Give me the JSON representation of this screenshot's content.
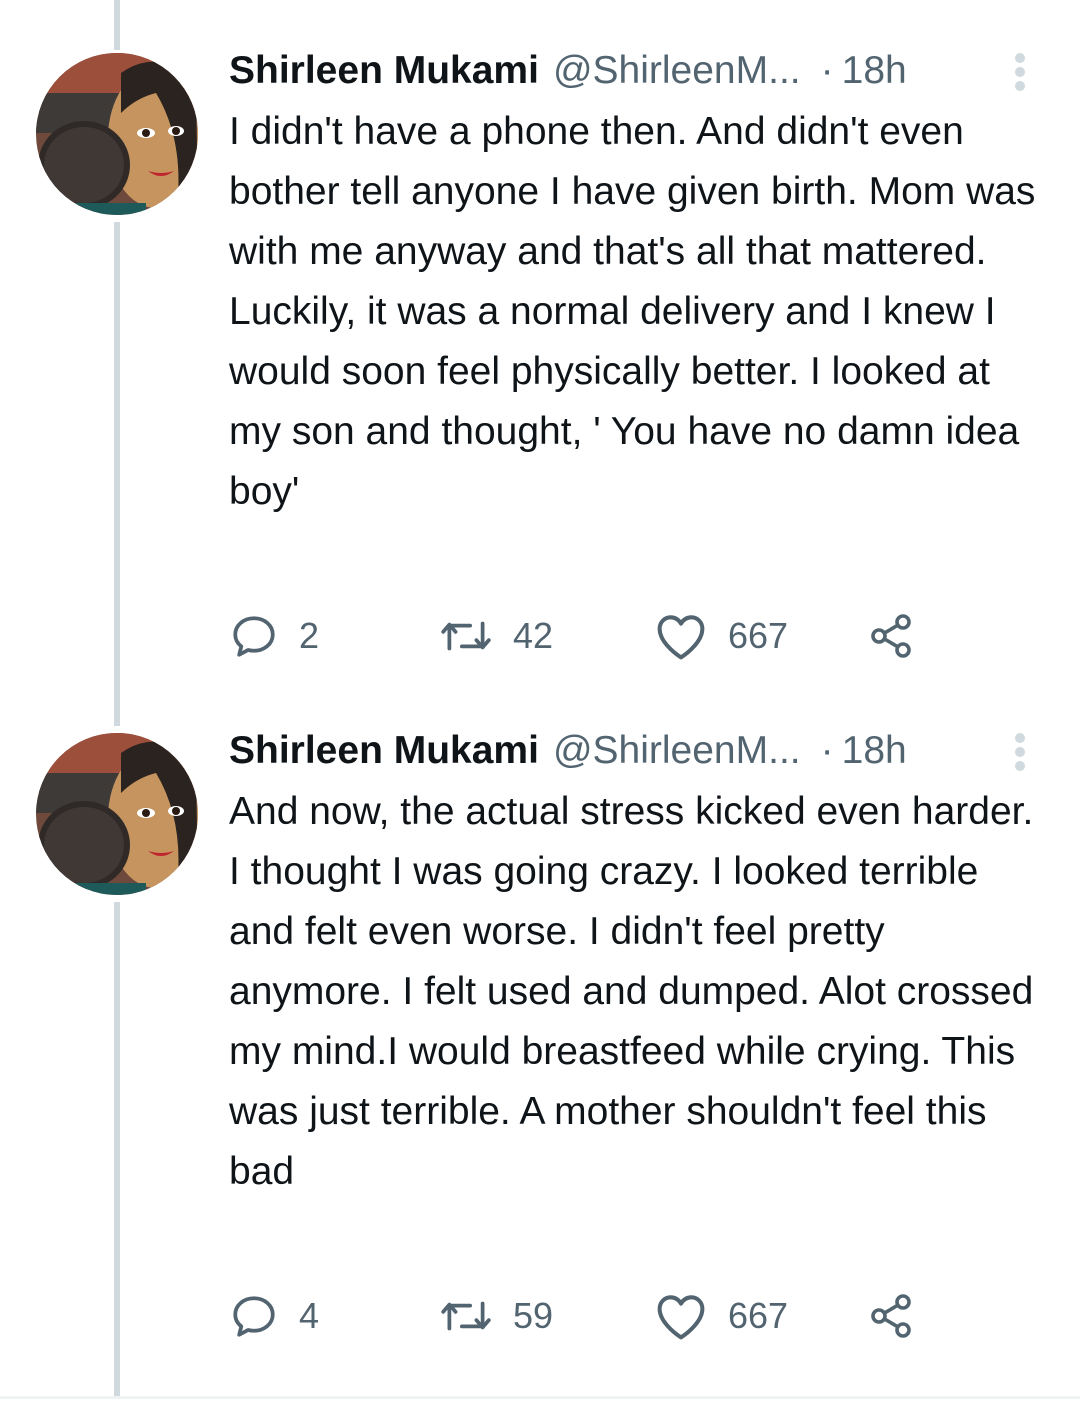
{
  "colors": {
    "text_primary": "#0f1419",
    "text_secondary": "#536471",
    "thread_line": "#cfd9de"
  },
  "tweets": [
    {
      "display_name": "Shirleen Mukami",
      "handle": "@ShirleenM...",
      "separator": "·",
      "time": "18h",
      "text": "I didn't have a phone then. And didn't even bother tell anyone I have given birth. Mom was with me anyway and that's all that mattered. Luckily, it was a normal delivery and I knew I would soon feel physically better. I looked at my son and thought, ' You have no damn idea boy'",
      "replies": "2",
      "retweets": "42",
      "likes": "667",
      "icons": [
        "reply-icon",
        "retweet-icon",
        "like-icon",
        "share-icon",
        "more-icon"
      ]
    },
    {
      "display_name": "Shirleen Mukami",
      "handle": "@ShirleenM...",
      "separator": "·",
      "time": "18h",
      "text": "And now, the actual stress kicked even harder. I thought I was going crazy. I looked terrible and felt even worse. I didn't feel pretty anymore. I felt used and dumped. Alot crossed my mind.I would breastfeed while crying. This was just terrible. A mother shouldn't feel this bad",
      "replies": "4",
      "retweets": "59",
      "likes": "667",
      "icons": [
        "reply-icon",
        "retweet-icon",
        "like-icon",
        "share-icon",
        "more-icon"
      ]
    }
  ]
}
